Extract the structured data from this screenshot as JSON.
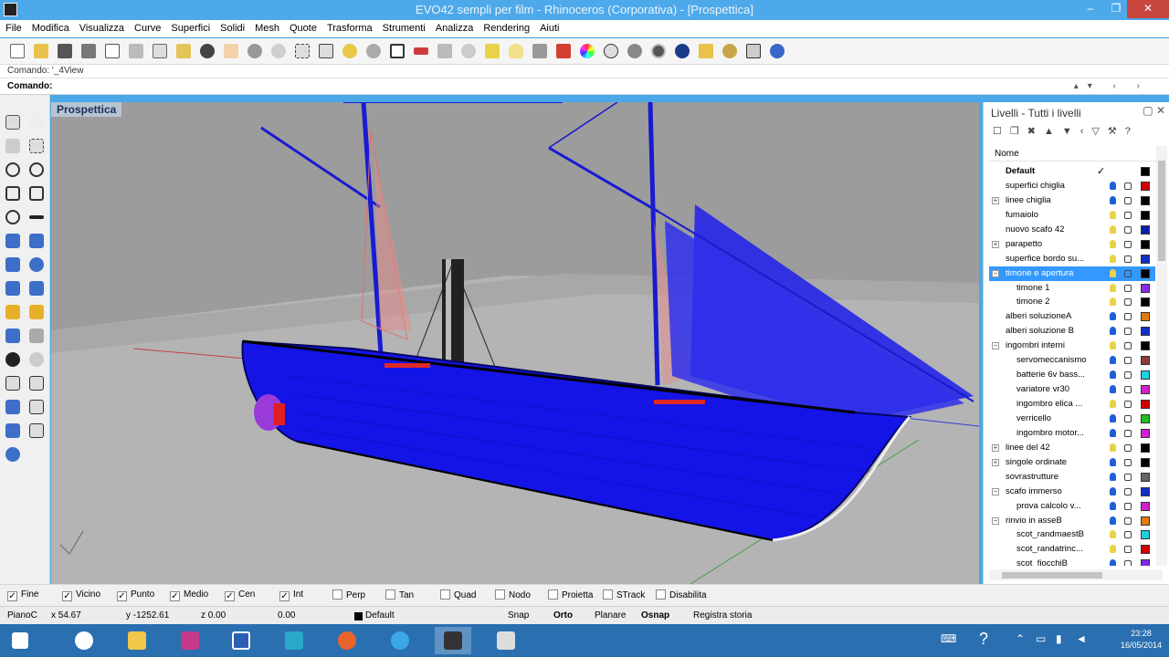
{
  "window": {
    "title": "EVO42 sempli per film - Rhinoceros (Corporativa) - [Prospettica]",
    "btn_min": "–",
    "btn_max": "❐",
    "btn_close": "✕"
  },
  "menu": [
    "File",
    "Modifica",
    "Visualizza",
    "Curve",
    "Superfici",
    "Solidi",
    "Mesh",
    "Quote",
    "Trasforma",
    "Strumenti",
    "Analizza",
    "Rendering",
    "Aiuti"
  ],
  "command": {
    "history": "Comando: '_4View",
    "prompt": "Comando:",
    "nav": "▴▾ ‹ ›"
  },
  "viewport": {
    "label": "Prospettica"
  },
  "layers": {
    "title": "Livelli - Tutti i livelli",
    "head_buttons": "▢ ✕",
    "tools": "☐❐✖▲▼‹▽⚒?",
    "column_name": "Nome",
    "rows": [
      {
        "name": "Default",
        "indent": 0,
        "expand": "",
        "bold": true,
        "current": "✓",
        "bulb": "",
        "color": "#000000"
      },
      {
        "name": "superfici chiglia",
        "indent": 0,
        "expand": "",
        "bulb": "#1f5fd6",
        "color": "#d40000"
      },
      {
        "name": "linee chiglia",
        "indent": 0,
        "expand": "+",
        "bulb": "#1f5fd6",
        "color": "#000000"
      },
      {
        "name": "fumaiolo",
        "indent": 0,
        "expand": "",
        "bulb": "#e8d24a",
        "color": "#000000"
      },
      {
        "name": "nuovo scafo 42",
        "indent": 0,
        "expand": "",
        "bulb": "#e8d24a",
        "color": "#0a1fa8"
      },
      {
        "name": "parapetto",
        "indent": 0,
        "expand": "+",
        "bulb": "#e8d24a",
        "color": "#000000"
      },
      {
        "name": "superfice bordo su...",
        "indent": 0,
        "expand": "",
        "bulb": "#e8d24a",
        "color": "#1030c8"
      },
      {
        "name": "timone e apertura",
        "indent": 0,
        "expand": "−",
        "bulb": "#e8d24a",
        "color": "#000000",
        "selected": true
      },
      {
        "name": "timone 1",
        "indent": 1,
        "expand": "",
        "bulb": "#e8d24a",
        "color": "#8a2be2"
      },
      {
        "name": "timone 2",
        "indent": 1,
        "expand": "",
        "bulb": "#e8d24a",
        "color": "#000000"
      },
      {
        "name": "alberi soluzioneA",
        "indent": 0,
        "expand": "",
        "bulb": "#1f5fd6",
        "color": "#e07a10"
      },
      {
        "name": "alberi soluzione B",
        "indent": 0,
        "expand": "",
        "bulb": "#1f5fd6",
        "color": "#1030c8"
      },
      {
        "name": "ingombri interni",
        "indent": 0,
        "expand": "−",
        "bulb": "#e8d24a",
        "color": "#000000"
      },
      {
        "name": "servomeccanismo",
        "indent": 1,
        "expand": "",
        "bulb": "#1f5fd6",
        "color": "#8b3a3a"
      },
      {
        "name": "batterie 6v bass...",
        "indent": 1,
        "expand": "",
        "bulb": "#1f5fd6",
        "color": "#20d0e0"
      },
      {
        "name": "variatore vr30",
        "indent": 1,
        "expand": "",
        "bulb": "#1f5fd6",
        "color": "#d020d0"
      },
      {
        "name": "ingombro elica ...",
        "indent": 1,
        "expand": "",
        "bulb": "#e8d24a",
        "color": "#d40000"
      },
      {
        "name": "verricello",
        "indent": 1,
        "expand": "",
        "bulb": "#1f5fd6",
        "color": "#20c020"
      },
      {
        "name": "ingombro motor...",
        "indent": 1,
        "expand": "",
        "bulb": "#1f5fd6",
        "color": "#d020d0"
      },
      {
        "name": "linee del 42",
        "indent": 0,
        "expand": "+",
        "bulb": "#e8d24a",
        "color": "#000000"
      },
      {
        "name": "singole ordinate",
        "indent": 0,
        "expand": "+",
        "bulb": "#1f5fd6",
        "color": "#000000"
      },
      {
        "name": "sovrastrutture",
        "indent": 0,
        "expand": "",
        "bulb": "#1f5fd6",
        "color": "#666666"
      },
      {
        "name": "scafo immerso",
        "indent": 0,
        "expand": "−",
        "bulb": "#1f5fd6",
        "color": "#1030c8"
      },
      {
        "name": "prova calcolo v...",
        "indent": 1,
        "expand": "",
        "bulb": "#1f5fd6",
        "color": "#d020d0"
      },
      {
        "name": "rinvio in asseB",
        "indent": 0,
        "expand": "−",
        "bulb": "#1f5fd6",
        "color": "#e07a10"
      },
      {
        "name": "scot_randmaestB",
        "indent": 1,
        "expand": "",
        "bulb": "#e8d24a",
        "color": "#20d0e0"
      },
      {
        "name": "scot_randatrinc...",
        "indent": 1,
        "expand": "",
        "bulb": "#e8d24a",
        "color": "#d40000"
      },
      {
        "name": "scot_fiocchiB",
        "indent": 1,
        "expand": "",
        "bulb": "#1f5fd6",
        "color": "#7a2be2"
      }
    ]
  },
  "osnap": [
    {
      "label": "Fine",
      "checked": true
    },
    {
      "label": "Vicino",
      "checked": true
    },
    {
      "label": "Punto",
      "checked": true
    },
    {
      "label": "Medio",
      "checked": true
    },
    {
      "label": "Cen",
      "checked": true
    },
    {
      "label": "Int",
      "checked": true
    },
    {
      "label": "Perp",
      "checked": false
    },
    {
      "label": "Tan",
      "checked": false
    },
    {
      "label": "Quad",
      "checked": false
    },
    {
      "label": "Nodo",
      "checked": false
    },
    {
      "label": "Proietta",
      "checked": false
    },
    {
      "label": "STrack",
      "checked": false
    },
    {
      "label": "Disabilita",
      "checked": false
    }
  ],
  "status": {
    "plane": "PianoC",
    "x": "x 54.67",
    "y": "y -1252.61",
    "z": "z 0.00",
    "dist": "0.00",
    "layer": "Default",
    "snap": "Snap",
    "orto": "Orto",
    "planare": "Planare",
    "osnap": "Osnap",
    "history": "Registra storia"
  },
  "taskbar": {
    "time": "23:28",
    "date": "16/05/2014"
  },
  "colors": {
    "hull": "#1414e6",
    "selection": "#3399ff",
    "titlebar": "#4ea9ea"
  }
}
